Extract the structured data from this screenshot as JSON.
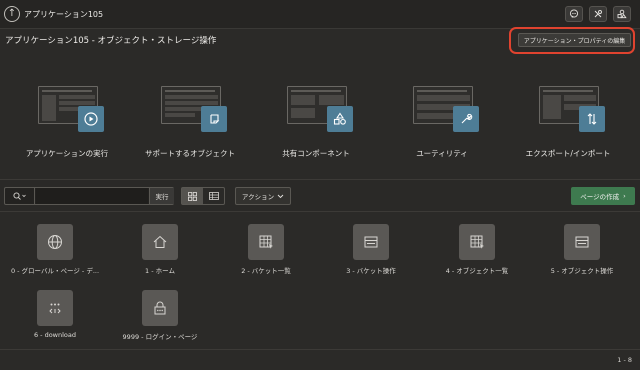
{
  "app": {
    "title": "アプリケーション105"
  },
  "page": {
    "title": "アプリケーション105 - オブジェクト・ストレージ操作",
    "edit_props_label": "アプリケーション・プロパティの編集"
  },
  "hero_tiles": [
    {
      "label": "アプリケーションの実行",
      "icon": "play-icon"
    },
    {
      "label": "サポートするオブジェクト",
      "icon": "scroll-icon"
    },
    {
      "label": "共有コンポーネント",
      "icon": "shapes-icon"
    },
    {
      "label": "ユーティリティ",
      "icon": "wrench-icon"
    },
    {
      "label": "エクスポート/インポート",
      "icon": "up-down-arrows-icon"
    }
  ],
  "toolbar": {
    "search_placeholder": "",
    "go_label": "実行",
    "actions_label": "アクション",
    "create_label": "ページの作成"
  },
  "pages": [
    {
      "label": "0 - グローバル・ページ - デ...",
      "icon": "globe-icon"
    },
    {
      "label": "1 - ホーム",
      "icon": "home-icon"
    },
    {
      "label": "2 - バケット一覧",
      "icon": "grid-cursor-icon"
    },
    {
      "label": "3 - バケット操作",
      "icon": "form-icon"
    },
    {
      "label": "4 - オブジェクト一覧",
      "icon": "grid-cursor-icon"
    },
    {
      "label": "5 - オブジェクト操作",
      "icon": "form-icon"
    },
    {
      "label": "6 - download",
      "icon": "dots-arrows-icon"
    },
    {
      "label": "9999 - ログイン・ページ",
      "icon": "login-icon"
    }
  ],
  "pager": {
    "text": "1 - 8"
  },
  "colors": {
    "highlight": "#e0432f",
    "create": "#3e7a4f",
    "badge": "#4e7d96"
  }
}
